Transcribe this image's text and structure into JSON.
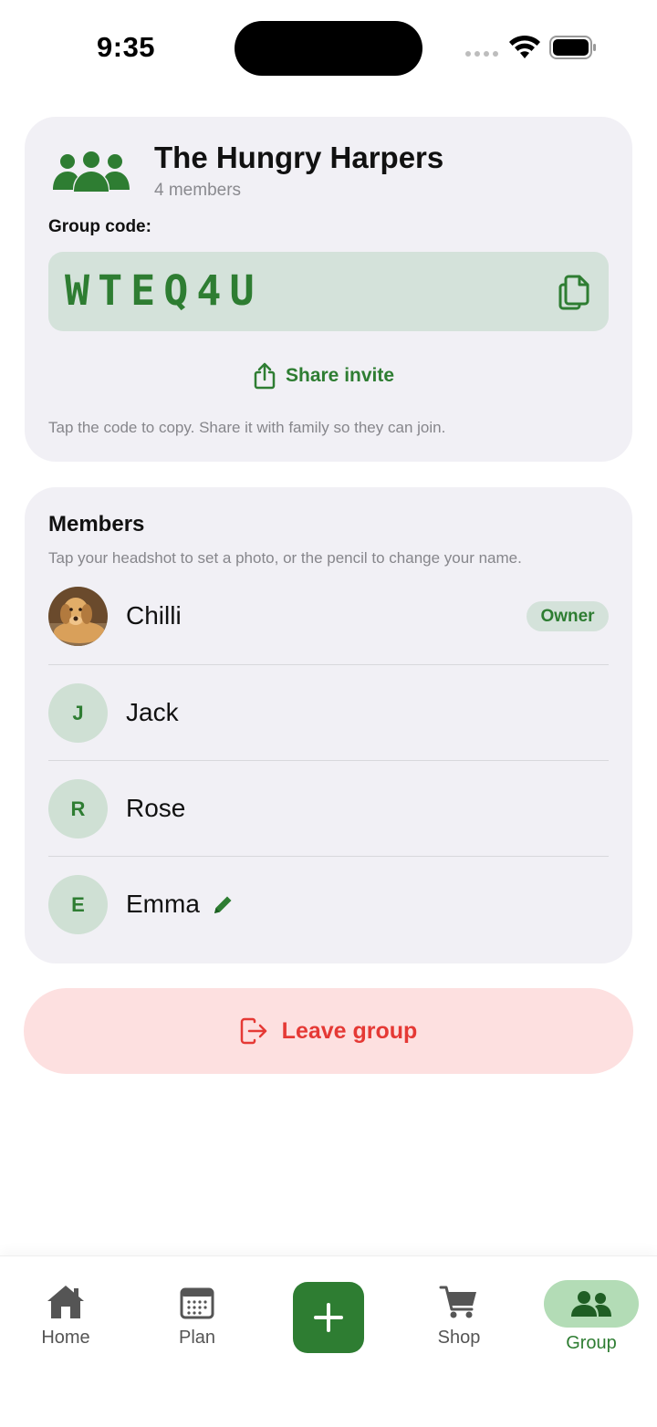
{
  "status_bar": {
    "time": "9:35"
  },
  "group": {
    "name": "The Hungry Harpers",
    "member_count": "4 members",
    "code_label": "Group code:",
    "code": "WTEQ4U",
    "share_label": "Share invite",
    "hint": "Tap the code to copy. Share it with family so they can join."
  },
  "members": {
    "title": "Members",
    "hint": "Tap your headshot to set a photo, or the pencil to change your name.",
    "list": [
      {
        "name": "Chilli",
        "initial": "",
        "badge": "Owner",
        "has_photo": true
      },
      {
        "name": "Jack",
        "initial": "J"
      },
      {
        "name": "Rose",
        "initial": "R"
      },
      {
        "name": "Emma",
        "initial": "E",
        "editable": true
      }
    ]
  },
  "leave": {
    "label": "Leave group"
  },
  "tabs": [
    {
      "label": "Home",
      "icon": "home-icon"
    },
    {
      "label": "Plan",
      "icon": "calendar-icon"
    },
    {
      "label": "",
      "icon": "plus-icon"
    },
    {
      "label": "Shop",
      "icon": "cart-icon"
    },
    {
      "label": "Group",
      "icon": "group-icon",
      "active": true
    }
  ],
  "colors": {
    "accent": "#2e7d32",
    "accent_soft": "#d4e2da",
    "danger": "#e53935",
    "danger_soft": "#fde0e0",
    "card_bg": "#f1f0f5"
  }
}
